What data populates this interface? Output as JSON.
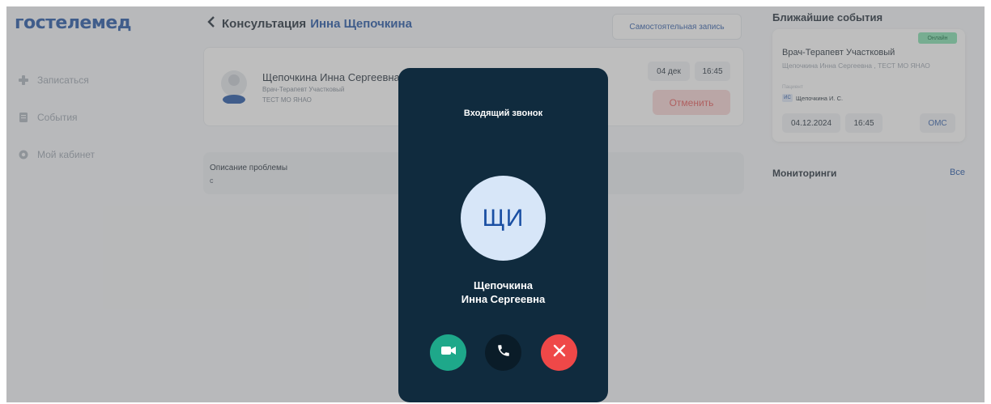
{
  "sidebar": {
    "logo": "гостелемед",
    "items": [
      {
        "label": "Записаться",
        "icon": "plus-icon"
      },
      {
        "label": "События",
        "icon": "document-icon"
      },
      {
        "label": "Мой кабинет",
        "icon": "gear-icon"
      }
    ]
  },
  "header": {
    "back_prefix": "Консультация",
    "doctor_name": "Инна Щепочкина",
    "self_booking_button": "Самостоятельная запись"
  },
  "appointment": {
    "doctor_name": "Щепочкина Инна Сергеевна",
    "specialty": "Врач-Терапевт Участковый",
    "organization": "ТЕСТ МО ЯНАО",
    "date": "04 дек",
    "time": "16:45",
    "cancel_button": "Отменить"
  },
  "problem": {
    "label": "Описание проблемы",
    "value": "с"
  },
  "events": {
    "title": "Ближайшие события",
    "badge": "Онлайн",
    "specialty": "Врач-Терапевт Участковый",
    "doctor": "Щепочкина Инна Сергеевна , ТЕСТ МО ЯНАО",
    "role_label": "Пациент",
    "patient_initials": "ИС",
    "patient_name": "Щепочкина И. С.",
    "date": "04.12.2024",
    "time": "16:45",
    "insurance": "ОМС"
  },
  "monitoring": {
    "title": "Мониторинги",
    "all_link": "Все"
  },
  "call": {
    "title": "Входящий звонок",
    "initials": "ЩИ",
    "name_line1": "Щепочкина",
    "name_line2": "Инна Сергеевна",
    "buttons": [
      "video-call-icon",
      "phone-icon",
      "close-icon"
    ]
  },
  "colors": {
    "brand": "#1a4fa3",
    "modal_bg": "#102b3e",
    "accept_video": "#1ea88a",
    "decline": "#ef4848"
  }
}
